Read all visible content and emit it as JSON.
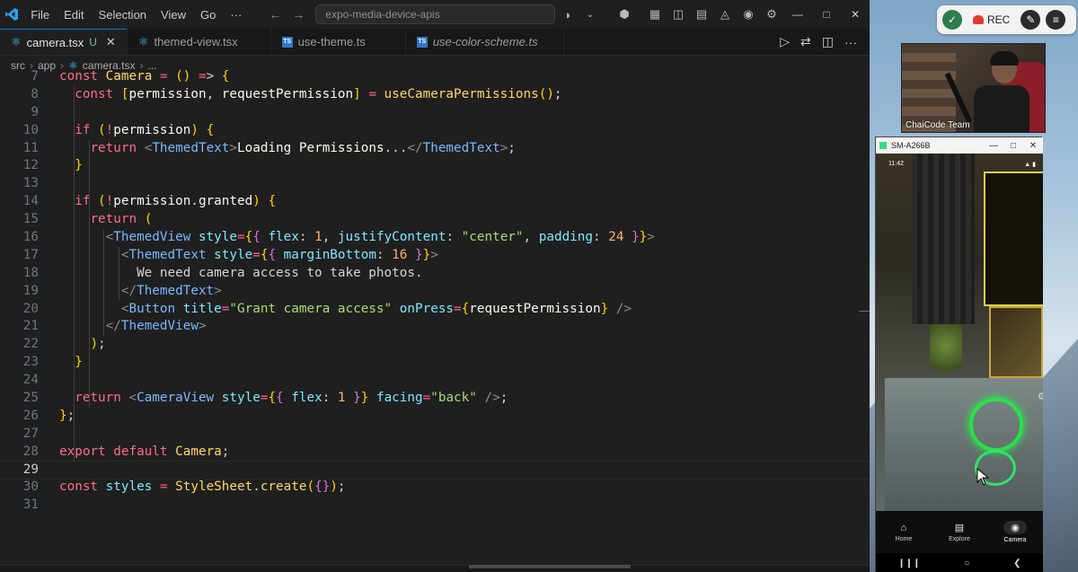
{
  "vscode": {
    "menu": [
      "File",
      "Edit",
      "Selection",
      "View",
      "Go",
      "···"
    ],
    "command_center": "expo-media-device-apis",
    "tabs": [
      {
        "label": "camera.tsx",
        "icon": "react-icon",
        "modified": "U",
        "active": true
      },
      {
        "label": "themed-view.tsx",
        "icon": "react-icon",
        "active": false
      },
      {
        "label": "use-theme.ts",
        "icon": "ts-icon",
        "active": false
      },
      {
        "label": "use-color-scheme.ts",
        "icon": "ts-icon",
        "active": false,
        "italic": true
      }
    ],
    "breadcrumb": [
      "src",
      "app",
      "camera.tsx",
      "..."
    ],
    "current_line": 29
  },
  "code_lines": [
    {
      "n": "7",
      "text": "const Camera = () => {"
    },
    {
      "n": "8",
      "text": "  const [permission, requestPermission] = useCameraPermissions();"
    },
    {
      "n": "9",
      "text": ""
    },
    {
      "n": "10",
      "text": "  if (!permission) {"
    },
    {
      "n": "11",
      "text": "    return <ThemedText>Loading Permissions...</ThemedText>;"
    },
    {
      "n": "12",
      "text": "  }"
    },
    {
      "n": "13",
      "text": ""
    },
    {
      "n": "14",
      "text": "  if (!permission.granted) {"
    },
    {
      "n": "15",
      "text": "    return ("
    },
    {
      "n": "16",
      "text": "      <ThemedView style={{ flex: 1, justifyContent: \"center\", padding: 24 }}>"
    },
    {
      "n": "17",
      "text": "        <ThemedText style={{ marginBottom: 16 }}>"
    },
    {
      "n": "18",
      "text": "          We need camera access to take photos."
    },
    {
      "n": "19",
      "text": "        </ThemedText>"
    },
    {
      "n": "20",
      "text": "        <Button title=\"Grant camera access\" onPress={requestPermission} />"
    },
    {
      "n": "21",
      "text": "      </ThemedView>"
    },
    {
      "n": "22",
      "text": "    );"
    },
    {
      "n": "23",
      "text": "  }"
    },
    {
      "n": "24",
      "text": ""
    },
    {
      "n": "25",
      "text": "  return <CameraView style={{ flex: 1 }} facing=\"back\" />;"
    },
    {
      "n": "26",
      "text": "};"
    },
    {
      "n": "27",
      "text": ""
    },
    {
      "n": "28",
      "text": "export default Camera;"
    },
    {
      "n": "29",
      "text": ""
    },
    {
      "n": "30",
      "text": "const styles = StyleSheet.create({});"
    },
    {
      "n": "31",
      "text": ""
    }
  ],
  "recorder": {
    "rec_label": "REC"
  },
  "webcam": {
    "label": "ChaiCode Team"
  },
  "phone": {
    "window_title": "SM-A266B",
    "time": "11:42",
    "tabs": [
      {
        "label": "Home",
        "icon": "home-icon",
        "active": false
      },
      {
        "label": "Explore",
        "icon": "explore-icon",
        "active": false
      },
      {
        "label": "Camera",
        "icon": "camera-icon",
        "active": true
      }
    ]
  },
  "colors": {
    "keyword": "#ff6b8a",
    "function": "#ffd866",
    "tag": "#7ab8ff",
    "attribute": "#7ee7ff",
    "string": "#a9dc76",
    "number": "#ffb46b",
    "accent": "#0078d4"
  }
}
